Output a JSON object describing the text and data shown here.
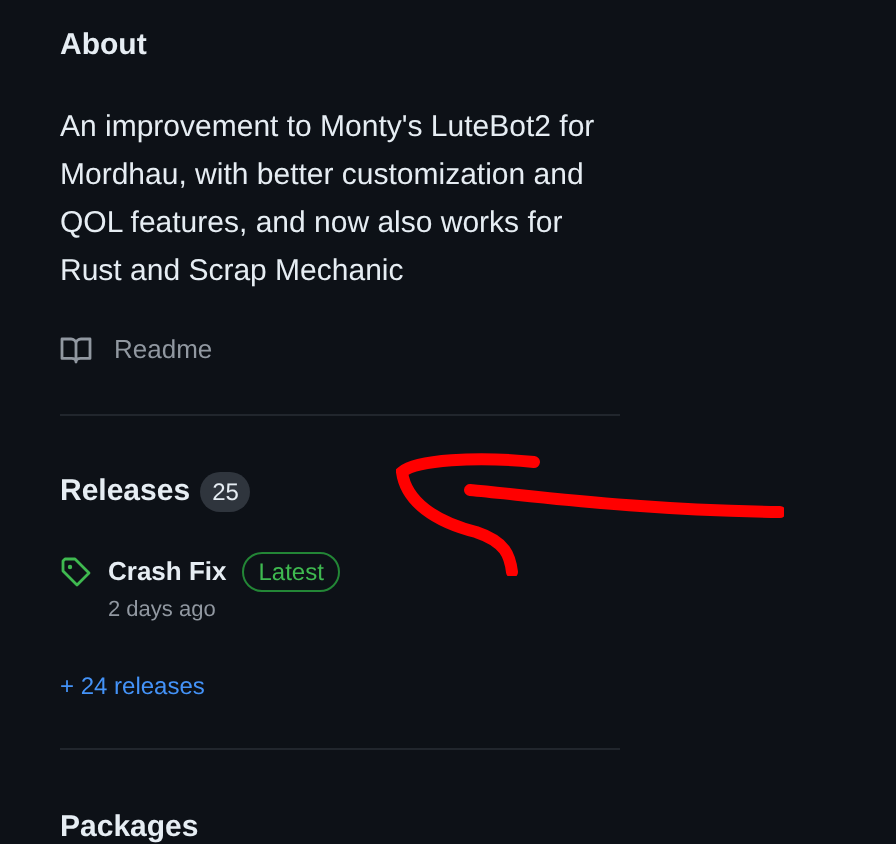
{
  "about": {
    "title": "About",
    "description": "An improvement to Monty's LuteBot2 for Mordhau, with better customization and QOL features, and now also works for Rust and Scrap Mechanic",
    "readme": "Readme"
  },
  "releases": {
    "title": "Releases",
    "count": "25",
    "items": [
      {
        "name": "Crash Fix",
        "badge": "Latest",
        "time": "2 days ago"
      }
    ],
    "more": "+ 24 releases"
  },
  "packages": {
    "title": "Packages"
  }
}
